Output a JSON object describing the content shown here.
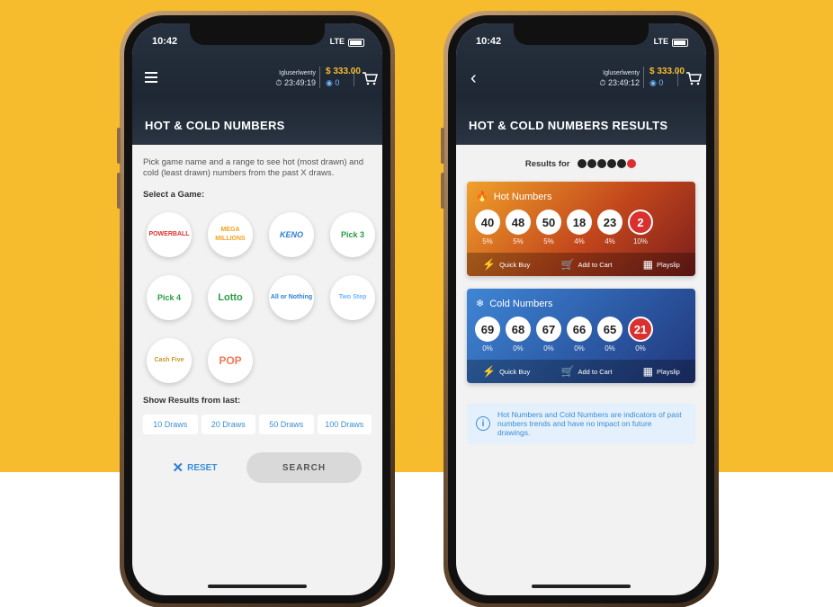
{
  "status": {
    "time": "10:42",
    "network": "LTE"
  },
  "account": {
    "username": "Igluserlwenty",
    "timer_left": "23:49:19",
    "timer_right": "23:49:12",
    "balance": "$ 333.00",
    "coins": "0"
  },
  "left_screen": {
    "title": "HOT & COLD NUMBERS",
    "intro": "Pick game name and a range to see hot (most drawn) and cold (least drawn) numbers from the past X draws.",
    "select_label": "Select a Game:",
    "games": [
      {
        "label": "POWERBALL",
        "color": "#d8312f"
      },
      {
        "label": "MEGA MILLIONS",
        "color": "#f6a21a"
      },
      {
        "label": "KENO",
        "color": "#2d7fd3"
      },
      {
        "label": "Pick 3",
        "color": "#2a9d46"
      },
      {
        "label": "Pick 4",
        "color": "#2a9d46"
      },
      {
        "label": "Lotto",
        "color": "#2a9d46"
      },
      {
        "label": "All or Nothing",
        "color": "#2d7fd3"
      },
      {
        "label": "Two Step",
        "color": "#6fb6ff"
      },
      {
        "label": "Cash Five",
        "color": "#c99b2b"
      },
      {
        "label": "POP",
        "color": "#f07a5a"
      }
    ],
    "show_label": "Show Results from last:",
    "draws": [
      "10 Draws",
      "20 Draws",
      "50 Draws",
      "100 Draws"
    ],
    "reset_label": "RESET",
    "search_label": "SEARCH"
  },
  "right_screen": {
    "title": "HOT & COLD NUMBERS RESULTS",
    "results_for": "Results for",
    "hot": {
      "heading": "Hot Numbers",
      "balls": [
        {
          "n": "40",
          "p": "5%"
        },
        {
          "n": "48",
          "p": "5%"
        },
        {
          "n": "50",
          "p": "5%"
        },
        {
          "n": "18",
          "p": "4%"
        },
        {
          "n": "23",
          "p": "4%"
        },
        {
          "n": "2",
          "p": "10%"
        }
      ]
    },
    "cold": {
      "heading": "Cold Numbers",
      "balls": [
        {
          "n": "69",
          "p": "0%"
        },
        {
          "n": "68",
          "p": "0%"
        },
        {
          "n": "67",
          "p": "0%"
        },
        {
          "n": "66",
          "p": "0%"
        },
        {
          "n": "65",
          "p": "0%"
        },
        {
          "n": "21",
          "p": "0%"
        }
      ]
    },
    "footer": {
      "quick_buy": "Quick Buy",
      "add_to_cart": "Add to Cart",
      "playslip": "Playslip"
    },
    "note": "Hot Numbers and Cold Numbers are indicators of past numbers trends and have no impact on future drawings."
  }
}
